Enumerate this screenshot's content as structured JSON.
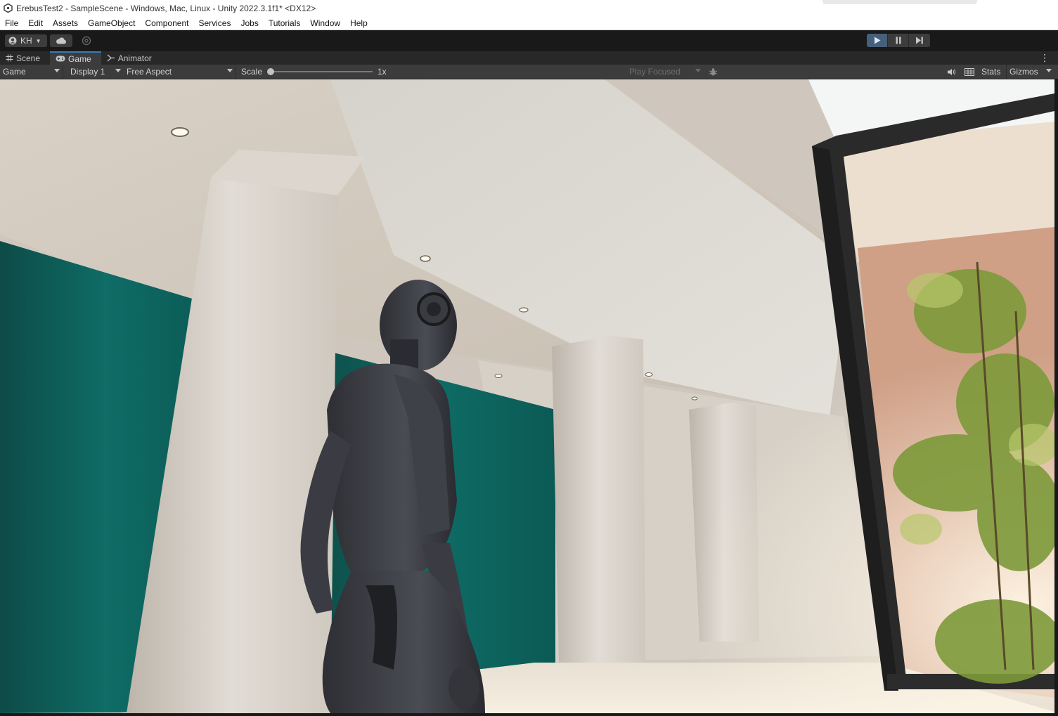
{
  "window": {
    "title": "ErebusTest2 - SampleScene - Windows, Mac, Linux - Unity 2022.3.1f1* <DX12>"
  },
  "menu": {
    "items": [
      "File",
      "Edit",
      "Assets",
      "GameObject",
      "Component",
      "Services",
      "Jobs",
      "Tutorials",
      "Window",
      "Help"
    ]
  },
  "toolbar": {
    "account_label": "KH",
    "account_icon": "account-icon",
    "cloud_icon": "cloud-icon",
    "collab_icon": "collab-icon",
    "play_icon": "play-icon",
    "pause_icon": "pause-icon",
    "step_icon": "step-icon",
    "play_active_color": "#46607c"
  },
  "tabs": [
    {
      "label": "Scene",
      "icon": "grid-icon",
      "active": false
    },
    {
      "label": "Game",
      "icon": "gamepad-icon",
      "active": true
    },
    {
      "label": "Animator",
      "icon": "animator-icon",
      "active": false
    }
  ],
  "game_toolbar": {
    "view_select": "Game",
    "display_select": "Display 1",
    "aspect_select": "Free Aspect",
    "scale_label": "Scale",
    "scale_value": "1x",
    "scale_fraction": 0.0,
    "play_mode_select": "Play Focused",
    "bug_icon": "bug-icon",
    "audio_icon": "speaker-icon",
    "stats_icon": "stats-grid-icon",
    "stats_label": "Stats",
    "gizmos_label": "Gizmos"
  },
  "accent_color": "#3a79bb"
}
